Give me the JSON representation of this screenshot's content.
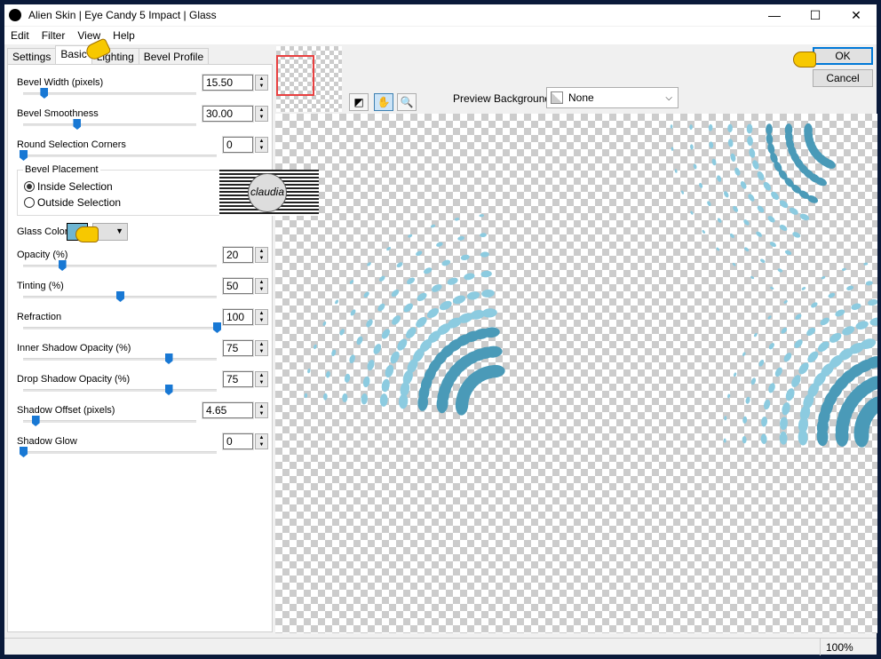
{
  "window": {
    "title": "Alien Skin | Eye Candy 5 Impact | Glass",
    "minimize": "—",
    "maximize": "☐",
    "close": "✕"
  },
  "menu": [
    "Edit",
    "Filter",
    "View",
    "Help"
  ],
  "tabs": [
    {
      "label": "Settings"
    },
    {
      "label": "Basic",
      "active": true
    },
    {
      "label": "Lighting"
    },
    {
      "label": "Bevel Profile"
    }
  ],
  "controls": {
    "bevel_width": {
      "label": "Bevel Width (pixels)",
      "value": "15.50",
      "slider": 0.12
    },
    "bevel_smoothness": {
      "label": "Bevel Smoothness",
      "value": "30.00",
      "slider": 0.31
    },
    "round_corners": {
      "label": "Round Selection Corners",
      "value": "0",
      "slider": 0
    },
    "bevel_placement": {
      "label": "Bevel Placement",
      "options": [
        "Inside Selection",
        "Outside Selection"
      ],
      "selected": "Inside Selection"
    },
    "glass_color": {
      "label": "Glass Color",
      "color": "#6fb6d2"
    },
    "opacity": {
      "label": "Opacity (%)",
      "value": "20",
      "slider": 0.2
    },
    "tinting": {
      "label": "Tinting (%)",
      "value": "50",
      "slider": 0.5
    },
    "refraction": {
      "label": "Refraction",
      "value": "100",
      "slider": 1.0
    },
    "inner_shadow": {
      "label": "Inner Shadow Opacity (%)",
      "value": "75",
      "slider": 0.75
    },
    "drop_shadow": {
      "label": "Drop Shadow Opacity (%)",
      "value": "75",
      "slider": 0.75
    },
    "shadow_offset": {
      "label": "Shadow Offset (pixels)",
      "value": "4.65",
      "slider": 0.07
    },
    "shadow_glow": {
      "label": "Shadow Glow",
      "value": "0",
      "slider": 0
    }
  },
  "watermark": "claudia",
  "buttons": {
    "ok": "OK",
    "cancel": "Cancel"
  },
  "preview_background": {
    "label": "Preview Background:",
    "value": "None"
  },
  "status": {
    "zoom": "100%"
  },
  "colors": {
    "accent": "#1878d4",
    "glass": "#4a9ab8"
  }
}
